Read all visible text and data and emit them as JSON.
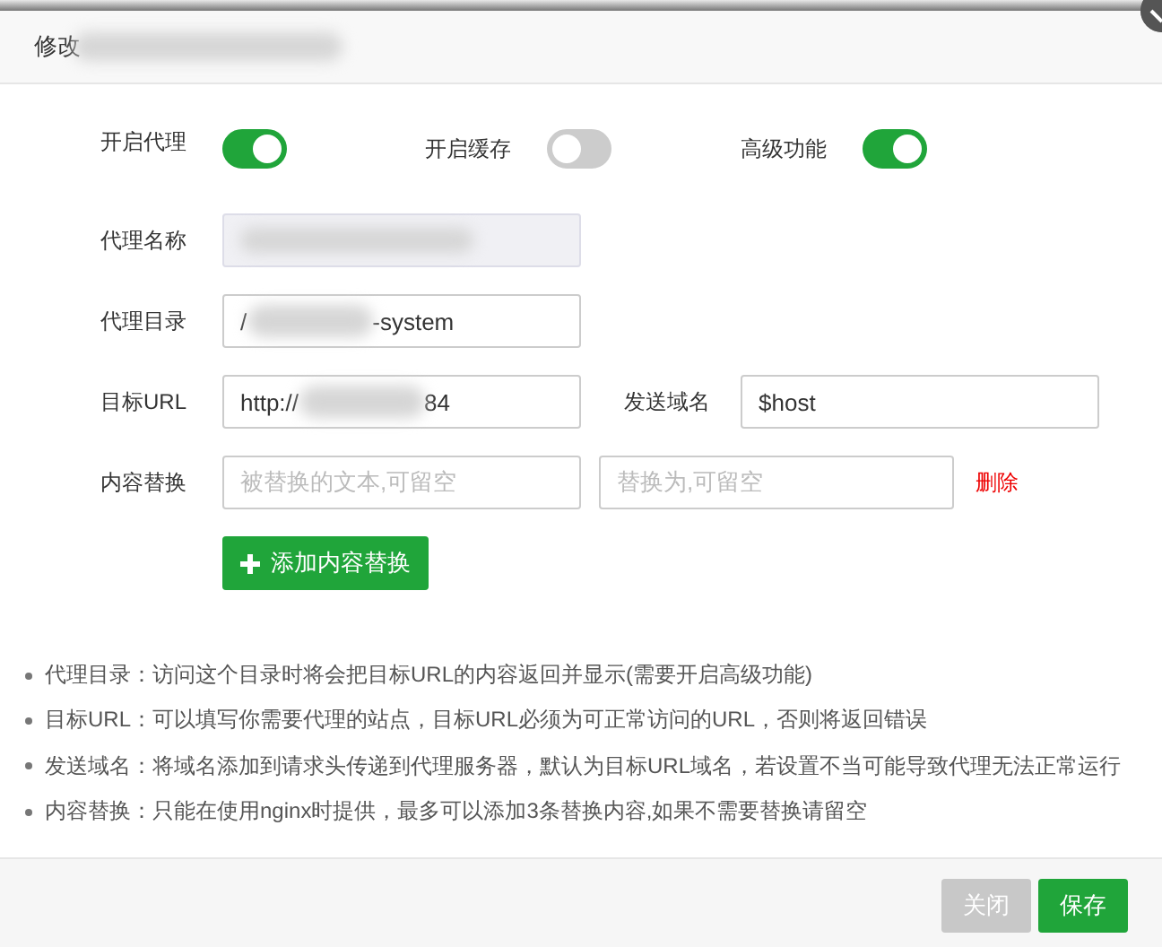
{
  "dialog": {
    "title": "修改",
    "title_redacted": true
  },
  "toggles": [
    {
      "label": "开启代理",
      "on": true
    },
    {
      "label": "开启缓存",
      "on": false
    },
    {
      "label": "高级功能",
      "on": true
    }
  ],
  "rows": [
    {
      "label": "代理名称",
      "inputs": [
        {
          "redacted": true,
          "disabled": true
        }
      ]
    },
    {
      "label": "代理目录",
      "inputs": [
        {
          "value_parts": [
            "/",
            "-system"
          ],
          "redacted": true,
          "disabled": false
        }
      ]
    },
    {
      "label": "目标URL",
      "inputs": [
        {
          "value_parts": [
            "http://",
            "84"
          ],
          "redacted": true,
          "disabled": false
        },
        {
          "label": "发送域名",
          "value_parts": [
            "$host"
          ],
          "disabled": false
        }
      ]
    },
    {
      "label": "内容替换",
      "inputs": [
        {
          "placeholder": "被替换的文本,可留空",
          "disabled": false
        },
        {
          "placeholder": "替换为,可留空",
          "disabled": false
        }
      ],
      "action": "删除"
    }
  ],
  "add_button": "添加内容替换",
  "notes": [
    "代理目录：访问这个目录时将会把目标URL的内容返回并显示(需要开启高级功能)",
    "目标URL：可以填写你需要代理的站点，目标URL必须为可正常访问的URL，否则将返回错误",
    "发送域名：将域名添加到请求头传递到代理服务器，默认为目标URL域名，若设置不当可能导致代理无法正常运行",
    "内容替换：只能在使用nginx时提供，最多可以添加3条替换内容,如果不需要替换请留空"
  ],
  "footer_buttons": [
    {
      "label": "关闭",
      "kind": "secondary"
    },
    {
      "label": "保存",
      "kind": "primary"
    }
  ]
}
